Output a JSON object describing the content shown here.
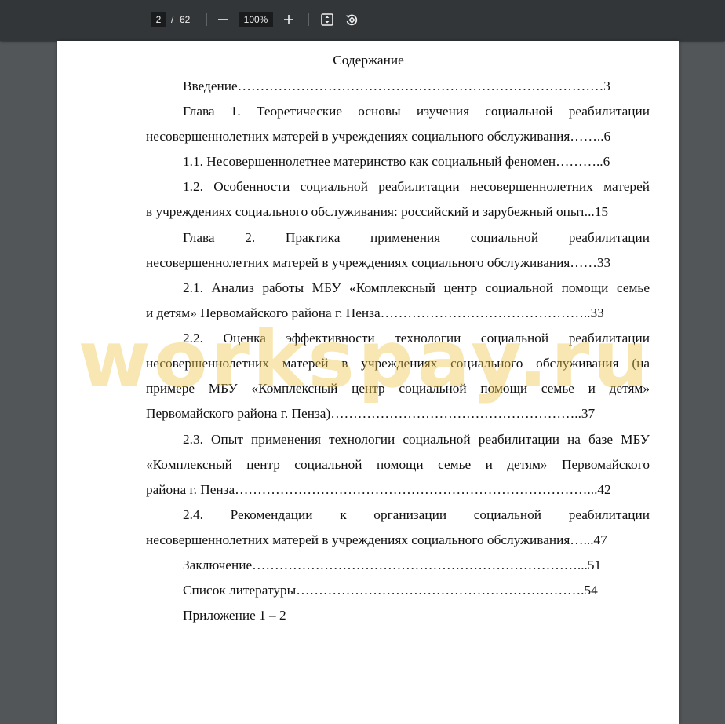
{
  "toolbar": {
    "page_current": "2",
    "page_separator": "/",
    "page_total": "62",
    "zoom_value": "100%"
  },
  "icons": {
    "zoom_out": "minus-icon",
    "zoom_in": "plus-icon",
    "fit": "fit-to-page-icon",
    "rotate": "rotate-icon"
  },
  "document": {
    "title": "Содержание",
    "toc_lines": [
      {
        "text": "Введение………………………………………………………………………3",
        "indent": true,
        "justify": false
      },
      {
        "text": "Глава 1. Теоретические основы изучения социальной реабилитации",
        "indent": true,
        "justify": true
      },
      {
        "text": "несовершеннолетних матерей в учреждениях социального обслуживания……..6",
        "indent": false,
        "justify": false
      },
      {
        "text": "1.1. Несовершеннолетнее материнство как социальный феномен………..6",
        "indent": true,
        "justify": false
      },
      {
        "text": "1.2. Особенности социальной реабилитации несовершеннолетних матерей",
        "indent": true,
        "justify": true
      },
      {
        "text": "в учреждениях социального обслуживания: российский и зарубежный опыт...15",
        "indent": false,
        "justify": false
      },
      {
        "text": "Глава 2. Практика применения социальной реабилитации",
        "indent": true,
        "justify": true
      },
      {
        "text": "несовершеннолетних матерей в учреждениях социального обслуживания……33",
        "indent": false,
        "justify": false
      },
      {
        "text": "2.1. Анализ работы МБУ «Комплексный центр социальной помощи семье",
        "indent": true,
        "justify": true
      },
      {
        "text": "и детям» Первомайского района г. Пенза………………………………………..33",
        "indent": false,
        "justify": false
      },
      {
        "text": "2.2. Оценка эффективности технологии социальной реабилитации",
        "indent": true,
        "justify": true
      },
      {
        "text": "несовершеннолетних матерей в учреждениях социального обслуживания (на",
        "indent": false,
        "justify": true
      },
      {
        "text": "примере МБУ «Комплексный центр социальной помощи семье и детям»",
        "indent": false,
        "justify": true
      },
      {
        "text": "Первомайского района г. Пенза)………………………………………………..37",
        "indent": false,
        "justify": false
      },
      {
        "text": "2.3. Опыт применения технологии социальной реабилитации на базе МБУ",
        "indent": true,
        "justify": true
      },
      {
        "text": "«Комплексный центр социальной помощи семье и детям» Первомайского",
        "indent": false,
        "justify": true
      },
      {
        "text": "района г. Пенза……………………………………………………………………...42",
        "indent": false,
        "justify": false
      },
      {
        "text": "2.4. Рекомендации к организации социальной реабилитации",
        "indent": true,
        "justify": true
      },
      {
        "text": "несовершеннолетних матерей в учреждениях социального обслуживания…...47",
        "indent": false,
        "justify": false
      },
      {
        "text": "Заключение………………………………………………………………...51",
        "indent": true,
        "justify": false
      },
      {
        "text": "Список литературы……………………………………………………….54",
        "indent": true,
        "justify": false
      },
      {
        "text": "Приложение 1 – 2",
        "indent": true,
        "justify": false
      }
    ]
  },
  "watermark": "workspay.ru"
}
